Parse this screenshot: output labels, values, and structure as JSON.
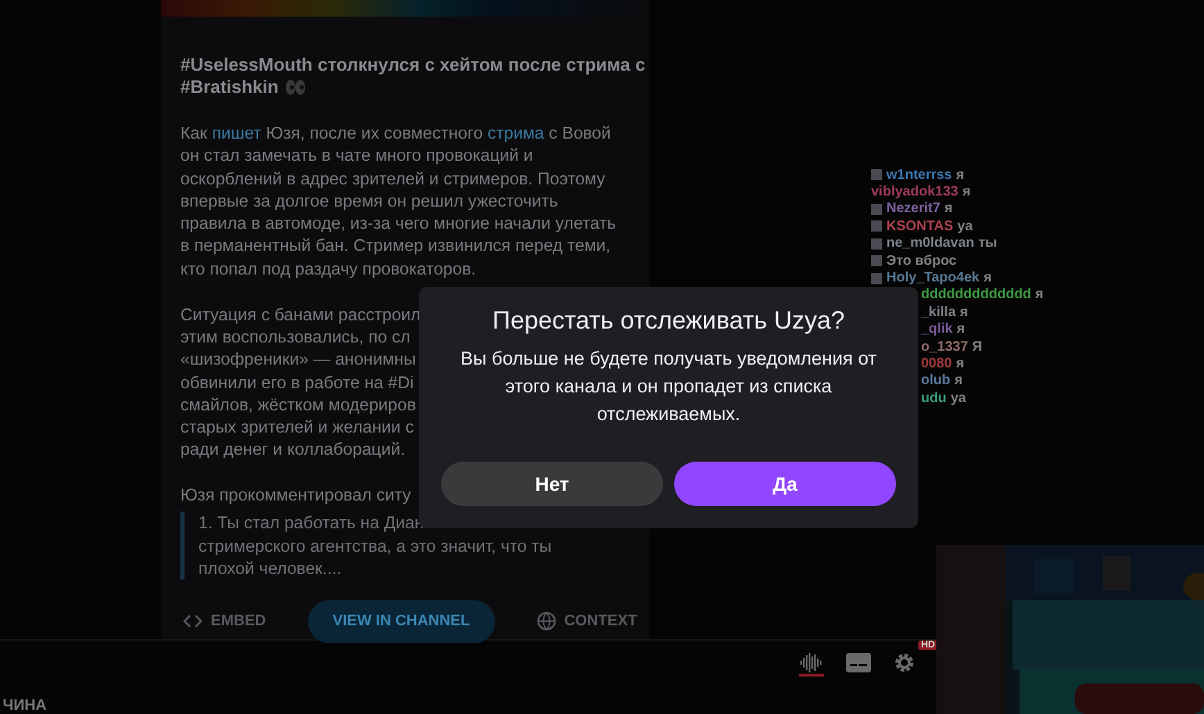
{
  "article": {
    "title_lines": [
      "#UselessMouth столкнулся с хейтом после стрима с",
      "#Bratishkin"
    ],
    "paragraphs": [
      {
        "lines": [
          [
            {
              "text": "Как "
            },
            {
              "text": "пишет",
              "link": true
            },
            {
              "text": " Юзя, после их совместного "
            },
            {
              "text": "стрима",
              "link": true
            },
            {
              "text": " с Вовой"
            }
          ],
          [
            {
              "text": "он стал замечать в чате много провокаций и"
            }
          ],
          [
            {
              "text": "оскорблений в адрес зрителей и стримеров. Поэтому"
            }
          ],
          [
            {
              "text": "впервые за долгое время он решил ужесточить"
            }
          ],
          [
            {
              "text": "правила в автомоде, из-за чего многие начали улетать"
            }
          ],
          [
            {
              "text": "в перманентный бан. Стример извинился перед теми,"
            }
          ],
          [
            {
              "text": "кто попал под раздачу провокаторов."
            }
          ]
        ]
      },
      {
        "lines": [
          [
            {
              "text": "Ситуация с банами расстроил"
            }
          ],
          [
            {
              "text": "этим воспользовались, по сл"
            }
          ],
          [
            {
              "text": "«шизофреники» — анонимны"
            }
          ],
          [
            {
              "text": "обвинили его в работе на #Di"
            }
          ],
          [
            {
              "text": "смайлов, жёстком модериров"
            }
          ],
          [
            {
              "text": "старых зрителей и желании с"
            }
          ],
          [
            {
              "text": "ради денег и коллабораций."
            }
          ]
        ]
      },
      {
        "lines": [
          [
            {
              "text": "Юзя прокомментировал ситу"
            }
          ]
        ]
      }
    ],
    "quote_lines": [
      "1. Ты стал работать на Диан",
      "стримерского агентства, а это значит, что ты",
      "плохой человек...."
    ],
    "footer": {
      "embed": "EMBED",
      "view": "VIEW IN CHANNEL",
      "context": "CONTEXT"
    }
  },
  "chat": [
    {
      "name": "w1nterrss",
      "color": "#3d78b0",
      "message": "я",
      "badge": true,
      "clipped": false
    },
    {
      "name": "viblyadok133",
      "color": "#a03a60",
      "message": "я",
      "badge": false,
      "clipped": false
    },
    {
      "name": "Nezerit7",
      "color": "#7a64a0",
      "message": "я",
      "badge": true,
      "clipped": false
    },
    {
      "name": "KSONTAS",
      "color": "#b04050",
      "message": "ya",
      "badge": true,
      "clipped": false
    },
    {
      "name": "ne_m0ldavan",
      "color": "#7a848e",
      "message": "ты",
      "badge": true,
      "clipped": false
    },
    {
      "message": "Это вброс",
      "badge": true,
      "clipped": false
    },
    {
      "name": "Holy_Tapo4ek",
      "color": "#5a7a94",
      "message": "я",
      "badge": true,
      "clipped": false
    },
    {
      "name": "ddddddddddddd",
      "color": "#3e9a46",
      "message": "я",
      "badge": false,
      "clipped": true
    },
    {
      "name": "_killa",
      "color": "#80808a",
      "message": "я",
      "badge": false,
      "clipped": true
    },
    {
      "name": "_qlik",
      "color": "#7a5a9a",
      "message": "я",
      "badge": false,
      "clipped": true
    },
    {
      "name": "o_1337",
      "color": "#906a6a",
      "message": "Я",
      "badge": false,
      "clipped": true
    },
    {
      "name": "0080",
      "color": "#a03a3a",
      "message": "я",
      "badge": false,
      "clipped": true
    },
    {
      "name": "olub",
      "color": "#5a7a9e",
      "message": "я",
      "badge": false,
      "clipped": true
    },
    {
      "name": "udu",
      "color": "#3a9a7c",
      "message": "ya",
      "badge": false,
      "clipped": true
    }
  ],
  "player": {
    "hd_badge": "HD",
    "audio_active": true
  },
  "bottom_label": "ЧИНА",
  "dialog": {
    "title": "Перестать отслеживать Uzya?",
    "body": "Вы больше не будете получать уведомления от этого канала и он пропадет из списка отслеживаемых.",
    "buttons": [
      {
        "label": "Нет",
        "kind": "secondary"
      },
      {
        "label": "Да",
        "kind": "primary"
      }
    ]
  }
}
